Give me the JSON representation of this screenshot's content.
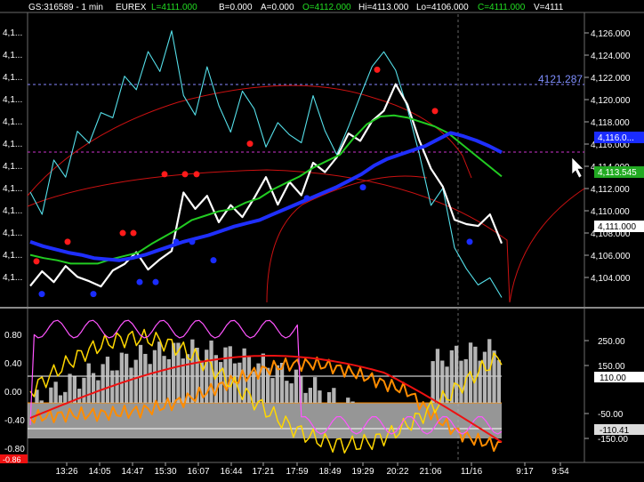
{
  "header": {
    "symbol": "GS:316589 - 1 min",
    "exchange": "EUREX",
    "last": "L=4111.000",
    "bid": "B=0.000",
    "ask": "A=0.000",
    "open": "O=4112.000",
    "high": "Hi=4113.000",
    "low": "Lo=4106.000",
    "close": "C=4111.000",
    "volume": "V=4111"
  },
  "colors": {
    "background": "#000000",
    "price": "#ffffff",
    "cyan_line": "#55e0ea",
    "fast_ma": "#22cc22",
    "slow_ma": "#1f2fff",
    "envelope": "#cc1111",
    "dot_high": "#ff1a1a",
    "dot_low": "#1a2cff",
    "osc_orange": "#ff8c00",
    "osc_yellow": "#ffd700",
    "osc_magenta": "#ff55ff",
    "osc_red": "#ee1111",
    "histogram": "#c8c8c8"
  },
  "price_axis": {
    "ticks": [
      "4,126.000",
      "4,124.000",
      "4,122.000",
      "4,120.000",
      "4,118.000",
      "4,116.000",
      "4,114.000",
      "4,112.000",
      "4,110.000",
      "4,108.000",
      "4,106.000",
      "4,104.000"
    ],
    "left_ticks": [
      "4,1...",
      "4,1...",
      "4,1...",
      "4,1...",
      "4,1...",
      "4,1...",
      "4,1...",
      "4,1...",
      "4,1...",
      "4,1...",
      "4,1...",
      "4,1..."
    ],
    "line_level_label": "4121.287",
    "badge_slow": "4,116.0...",
    "badge_fast": "4,113.545",
    "badge_last": "4,111.000"
  },
  "osc_axis": {
    "left_ticks": [
      "0.80",
      "0.40",
      "0.00",
      "-0.40",
      "-0.80"
    ],
    "left_badge": "-0.86",
    "right_ticks": [
      "250.00",
      "150.00",
      "-50.00",
      "-150.00"
    ],
    "right_badge_upper": "110.00",
    "right_badge_lower": "-110.41"
  },
  "time_axis": {
    "labels": [
      "13:26",
      "14:05",
      "14:47",
      "15:30",
      "16:07",
      "16:44",
      "17:21",
      "17:59",
      "18:49",
      "19:29",
      "20:22",
      "21:06",
      "11/16",
      "9:17",
      "9:54"
    ]
  },
  "chart_data": {
    "type": "line",
    "title": "",
    "xlabel": "",
    "ylabel": "",
    "ylim": [
      4102.6,
      4128.4
    ],
    "grid": false,
    "series": [
      {
        "key": "cyan",
        "values": [
          4112,
          4111,
          4115,
          4114,
          4118,
          4117,
          4120,
          4119,
          4123,
          4122,
          4126,
          4124,
          4127,
          4122,
          4120,
          4124,
          4121,
          4118,
          4122,
          4120,
          4117,
          4119,
          4118,
          4117,
          4121,
          4118,
          4116,
          4118,
          4121,
          4124,
          4126,
          4124,
          4120,
          4116,
          4111,
          4113,
          4108,
          4106,
          4104,
          4105,
          4103
        ]
      },
      {
        "key": "price",
        "values": [
          4104,
          4105,
          4104.5,
          4106,
          4105,
          4104.5,
          4104,
          4105,
          4106,
          4107,
          4106,
          4106.5,
          4107,
          4112,
          4111,
          4112,
          4110,
          4111,
          4110,
          4112,
          4114,
          4111,
          4113,
          4112,
          4115,
          4114,
          4116,
          4118,
          4117,
          4119,
          4120,
          4123,
          4121,
          4117,
          4115,
          4113,
          4110,
          4109.5,
          4109,
          4110,
          4108
        ]
      },
      {
        "key": "fast",
        "values": [
          4106.8,
          4106.5,
          4106.3,
          4106,
          4106,
          4106,
          4106.4,
          4106.7,
          4107,
          4107.8,
          4108.5,
          4109.2,
          4110,
          4110.4,
          4110.8,
          4111,
          4111.6,
          4112,
          4112.8,
          4113.4,
          4114,
          4114.8,
          4115.4,
          4116,
          4117.5,
          4118.8,
          4119.5,
          4119.6,
          4119.4,
          4119,
          4118.6,
          4118,
          4117,
          4116,
          4115,
          4114
        ]
      },
      {
        "key": "slow",
        "values": [
          4108,
          4107.6,
          4107.3,
          4107,
          4106.8,
          4106.5,
          4106.4,
          4106.3,
          4106.5,
          4106.8,
          4107.2,
          4107.6,
          4108,
          4108.3,
          4108.6,
          4109,
          4109.4,
          4109.7,
          4110,
          4110.5,
          4111,
          4111.5,
          4112,
          4112.5,
          4113,
          4113.6,
          4114.2,
          4115,
          4115.6,
          4116,
          4116.4,
          4116.8,
          4117.4,
          4118,
          4117.7,
          4117.3,
          4116.8,
          4116.2
        ]
      }
    ],
    "dots_high_values": [
      4106.2,
      4108,
      4108.8,
      4108.8,
      4114.2,
      4114.2,
      4114.2,
      4117,
      4123.8,
      4120
    ],
    "dots_low_values": [
      4103.2,
      4103.2,
      4104.3,
      4104.3,
      4108,
      4108,
      4106.3,
      4112,
      4113,
      4108
    ],
    "envelope_centers": [
      300.5,
      573.5
    ]
  }
}
